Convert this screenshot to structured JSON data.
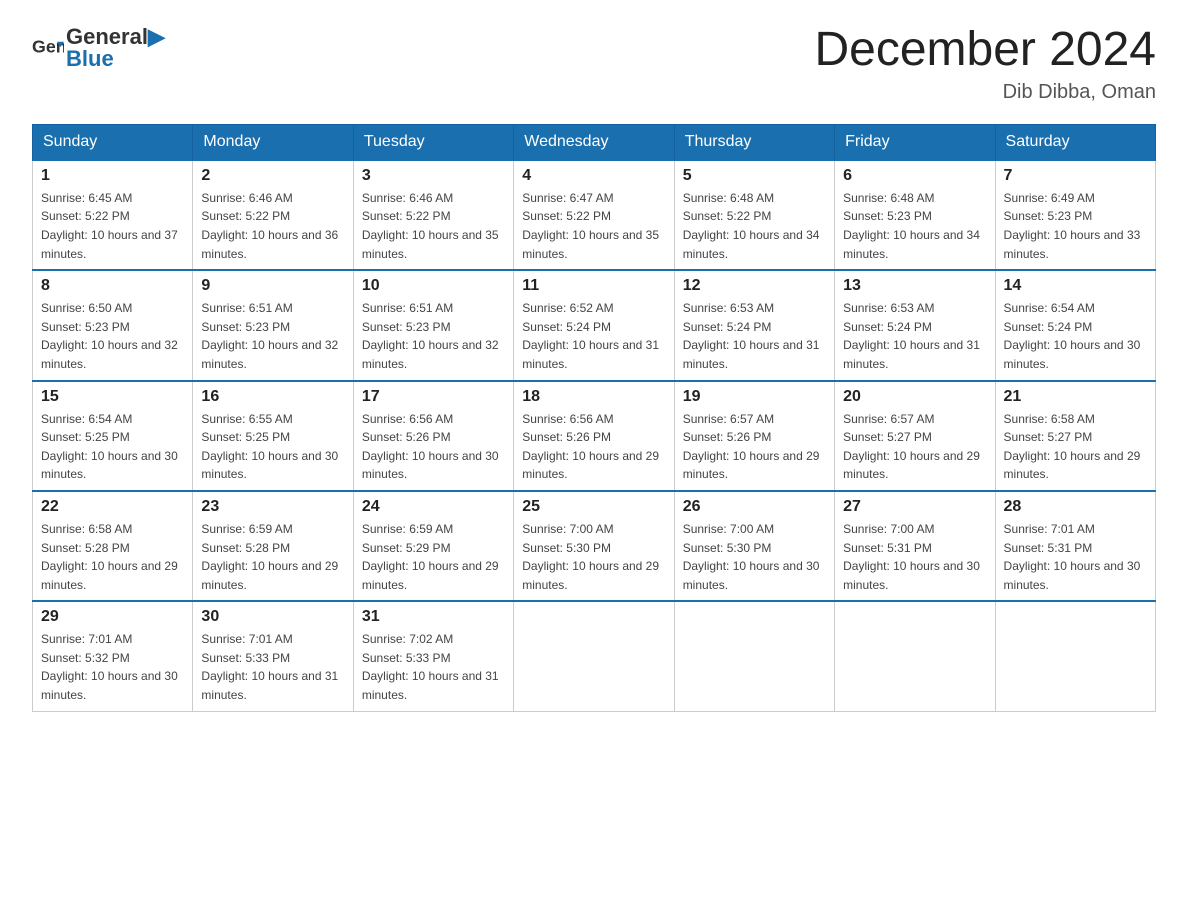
{
  "header": {
    "logo_text_black": "General",
    "logo_text_blue": "Blue",
    "month_title": "December 2024",
    "subtitle": "Dib Dibba, Oman"
  },
  "calendar": {
    "days_of_week": [
      "Sunday",
      "Monday",
      "Tuesday",
      "Wednesday",
      "Thursday",
      "Friday",
      "Saturday"
    ],
    "weeks": [
      [
        {
          "day": "1",
          "sunrise": "6:45 AM",
          "sunset": "5:22 PM",
          "daylight": "10 hours and 37 minutes."
        },
        {
          "day": "2",
          "sunrise": "6:46 AM",
          "sunset": "5:22 PM",
          "daylight": "10 hours and 36 minutes."
        },
        {
          "day": "3",
          "sunrise": "6:46 AM",
          "sunset": "5:22 PM",
          "daylight": "10 hours and 35 minutes."
        },
        {
          "day": "4",
          "sunrise": "6:47 AM",
          "sunset": "5:22 PM",
          "daylight": "10 hours and 35 minutes."
        },
        {
          "day": "5",
          "sunrise": "6:48 AM",
          "sunset": "5:22 PM",
          "daylight": "10 hours and 34 minutes."
        },
        {
          "day": "6",
          "sunrise": "6:48 AM",
          "sunset": "5:23 PM",
          "daylight": "10 hours and 34 minutes."
        },
        {
          "day": "7",
          "sunrise": "6:49 AM",
          "sunset": "5:23 PM",
          "daylight": "10 hours and 33 minutes."
        }
      ],
      [
        {
          "day": "8",
          "sunrise": "6:50 AM",
          "sunset": "5:23 PM",
          "daylight": "10 hours and 32 minutes."
        },
        {
          "day": "9",
          "sunrise": "6:51 AM",
          "sunset": "5:23 PM",
          "daylight": "10 hours and 32 minutes."
        },
        {
          "day": "10",
          "sunrise": "6:51 AM",
          "sunset": "5:23 PM",
          "daylight": "10 hours and 32 minutes."
        },
        {
          "day": "11",
          "sunrise": "6:52 AM",
          "sunset": "5:24 PM",
          "daylight": "10 hours and 31 minutes."
        },
        {
          "day": "12",
          "sunrise": "6:53 AM",
          "sunset": "5:24 PM",
          "daylight": "10 hours and 31 minutes."
        },
        {
          "day": "13",
          "sunrise": "6:53 AM",
          "sunset": "5:24 PM",
          "daylight": "10 hours and 31 minutes."
        },
        {
          "day": "14",
          "sunrise": "6:54 AM",
          "sunset": "5:24 PM",
          "daylight": "10 hours and 30 minutes."
        }
      ],
      [
        {
          "day": "15",
          "sunrise": "6:54 AM",
          "sunset": "5:25 PM",
          "daylight": "10 hours and 30 minutes."
        },
        {
          "day": "16",
          "sunrise": "6:55 AM",
          "sunset": "5:25 PM",
          "daylight": "10 hours and 30 minutes."
        },
        {
          "day": "17",
          "sunrise": "6:56 AM",
          "sunset": "5:26 PM",
          "daylight": "10 hours and 30 minutes."
        },
        {
          "day": "18",
          "sunrise": "6:56 AM",
          "sunset": "5:26 PM",
          "daylight": "10 hours and 29 minutes."
        },
        {
          "day": "19",
          "sunrise": "6:57 AM",
          "sunset": "5:26 PM",
          "daylight": "10 hours and 29 minutes."
        },
        {
          "day": "20",
          "sunrise": "6:57 AM",
          "sunset": "5:27 PM",
          "daylight": "10 hours and 29 minutes."
        },
        {
          "day": "21",
          "sunrise": "6:58 AM",
          "sunset": "5:27 PM",
          "daylight": "10 hours and 29 minutes."
        }
      ],
      [
        {
          "day": "22",
          "sunrise": "6:58 AM",
          "sunset": "5:28 PM",
          "daylight": "10 hours and 29 minutes."
        },
        {
          "day": "23",
          "sunrise": "6:59 AM",
          "sunset": "5:28 PM",
          "daylight": "10 hours and 29 minutes."
        },
        {
          "day": "24",
          "sunrise": "6:59 AM",
          "sunset": "5:29 PM",
          "daylight": "10 hours and 29 minutes."
        },
        {
          "day": "25",
          "sunrise": "7:00 AM",
          "sunset": "5:30 PM",
          "daylight": "10 hours and 29 minutes."
        },
        {
          "day": "26",
          "sunrise": "7:00 AM",
          "sunset": "5:30 PM",
          "daylight": "10 hours and 30 minutes."
        },
        {
          "day": "27",
          "sunrise": "7:00 AM",
          "sunset": "5:31 PM",
          "daylight": "10 hours and 30 minutes."
        },
        {
          "day": "28",
          "sunrise": "7:01 AM",
          "sunset": "5:31 PM",
          "daylight": "10 hours and 30 minutes."
        }
      ],
      [
        {
          "day": "29",
          "sunrise": "7:01 AM",
          "sunset": "5:32 PM",
          "daylight": "10 hours and 30 minutes."
        },
        {
          "day": "30",
          "sunrise": "7:01 AM",
          "sunset": "5:33 PM",
          "daylight": "10 hours and 31 minutes."
        },
        {
          "day": "31",
          "sunrise": "7:02 AM",
          "sunset": "5:33 PM",
          "daylight": "10 hours and 31 minutes."
        },
        null,
        null,
        null,
        null
      ]
    ],
    "sunrise_label": "Sunrise:",
    "sunset_label": "Sunset:",
    "daylight_label": "Daylight:"
  }
}
